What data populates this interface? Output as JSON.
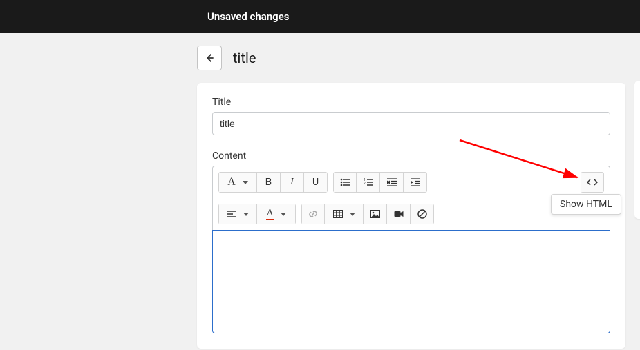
{
  "header": {
    "status": "Unsaved changes"
  },
  "page": {
    "title": "title"
  },
  "form": {
    "title_label": "Title",
    "title_value": "title",
    "content_label": "Content"
  },
  "toolbar": {
    "font_label": "A",
    "bold_label": "B",
    "italic_label": "I",
    "underline_label": "U",
    "color_label": "A"
  },
  "tooltip": {
    "show_html": "Show HTML"
  }
}
